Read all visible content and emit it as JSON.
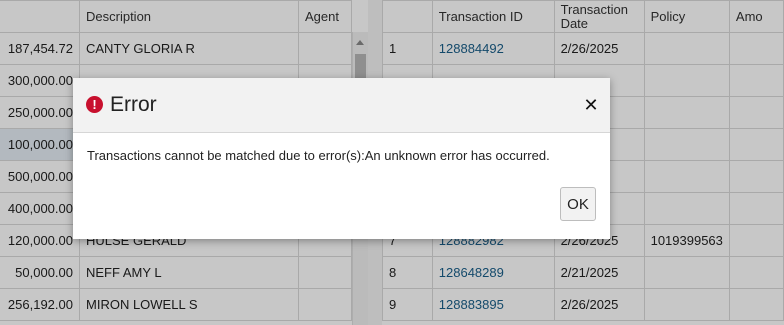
{
  "left_grid": {
    "headers": [
      "",
      "Description",
      "Agent"
    ],
    "rows": [
      {
        "amount": "187,454.72",
        "description": "CANTY GLORIA R",
        "agent": ""
      },
      {
        "amount": "300,000.00",
        "description": "",
        "agent": ""
      },
      {
        "amount": "250,000.00",
        "description": "",
        "agent": ""
      },
      {
        "amount": "100,000.00",
        "description": "",
        "agent": ""
      },
      {
        "amount": "500,000.00",
        "description": "",
        "agent": ""
      },
      {
        "amount": "400,000.00",
        "description": "",
        "agent": ""
      },
      {
        "amount": "120,000.00",
        "description": "HULSE GERALD",
        "agent": ""
      },
      {
        "amount": "50,000.00",
        "description": "NEFF AMY L",
        "agent": ""
      },
      {
        "amount": "256,192.00",
        "description": "MIRON LOWELL S",
        "agent": ""
      }
    ]
  },
  "right_grid": {
    "headers": [
      "",
      "Transaction ID",
      "Transaction Date",
      "Policy",
      "Amo"
    ],
    "rows": [
      {
        "num": "1",
        "transaction_id": "128884492",
        "date": "2/26/2025",
        "policy": "",
        "amount": ""
      },
      {
        "num": "",
        "transaction_id": "",
        "date": "",
        "policy": "",
        "amount": ""
      },
      {
        "num": "",
        "transaction_id": "",
        "date": "/2025",
        "policy": "",
        "amount": ""
      },
      {
        "num": "",
        "transaction_id": "",
        "date": "/2025",
        "policy": "",
        "amount": ""
      },
      {
        "num": "",
        "transaction_id": "",
        "date": "2025",
        "policy": "",
        "amount": ""
      },
      {
        "num": "",
        "transaction_id": "",
        "date": "/2025",
        "policy": "",
        "amount": ""
      },
      {
        "num": "7",
        "transaction_id": "128882982",
        "date": "2/26/2025",
        "policy": "1019399563",
        "amount": ""
      },
      {
        "num": "8",
        "transaction_id": "128648289",
        "date": "2/21/2025",
        "policy": "",
        "amount": ""
      },
      {
        "num": "9",
        "transaction_id": "128883895",
        "date": "2/26/2025",
        "policy": "",
        "amount": ""
      }
    ]
  },
  "dialog": {
    "title": "Error",
    "icon": "error-exclamation-icon",
    "icon_glyph": "!",
    "close_glyph": "✕",
    "message": "Transactions cannot be matched due to error(s):An unknown error has occurred.",
    "ok_label": "OK"
  },
  "colors": {
    "link": "#1a5f8a",
    "error_icon": "#c8102e",
    "selected_row": "#e6eef5"
  }
}
